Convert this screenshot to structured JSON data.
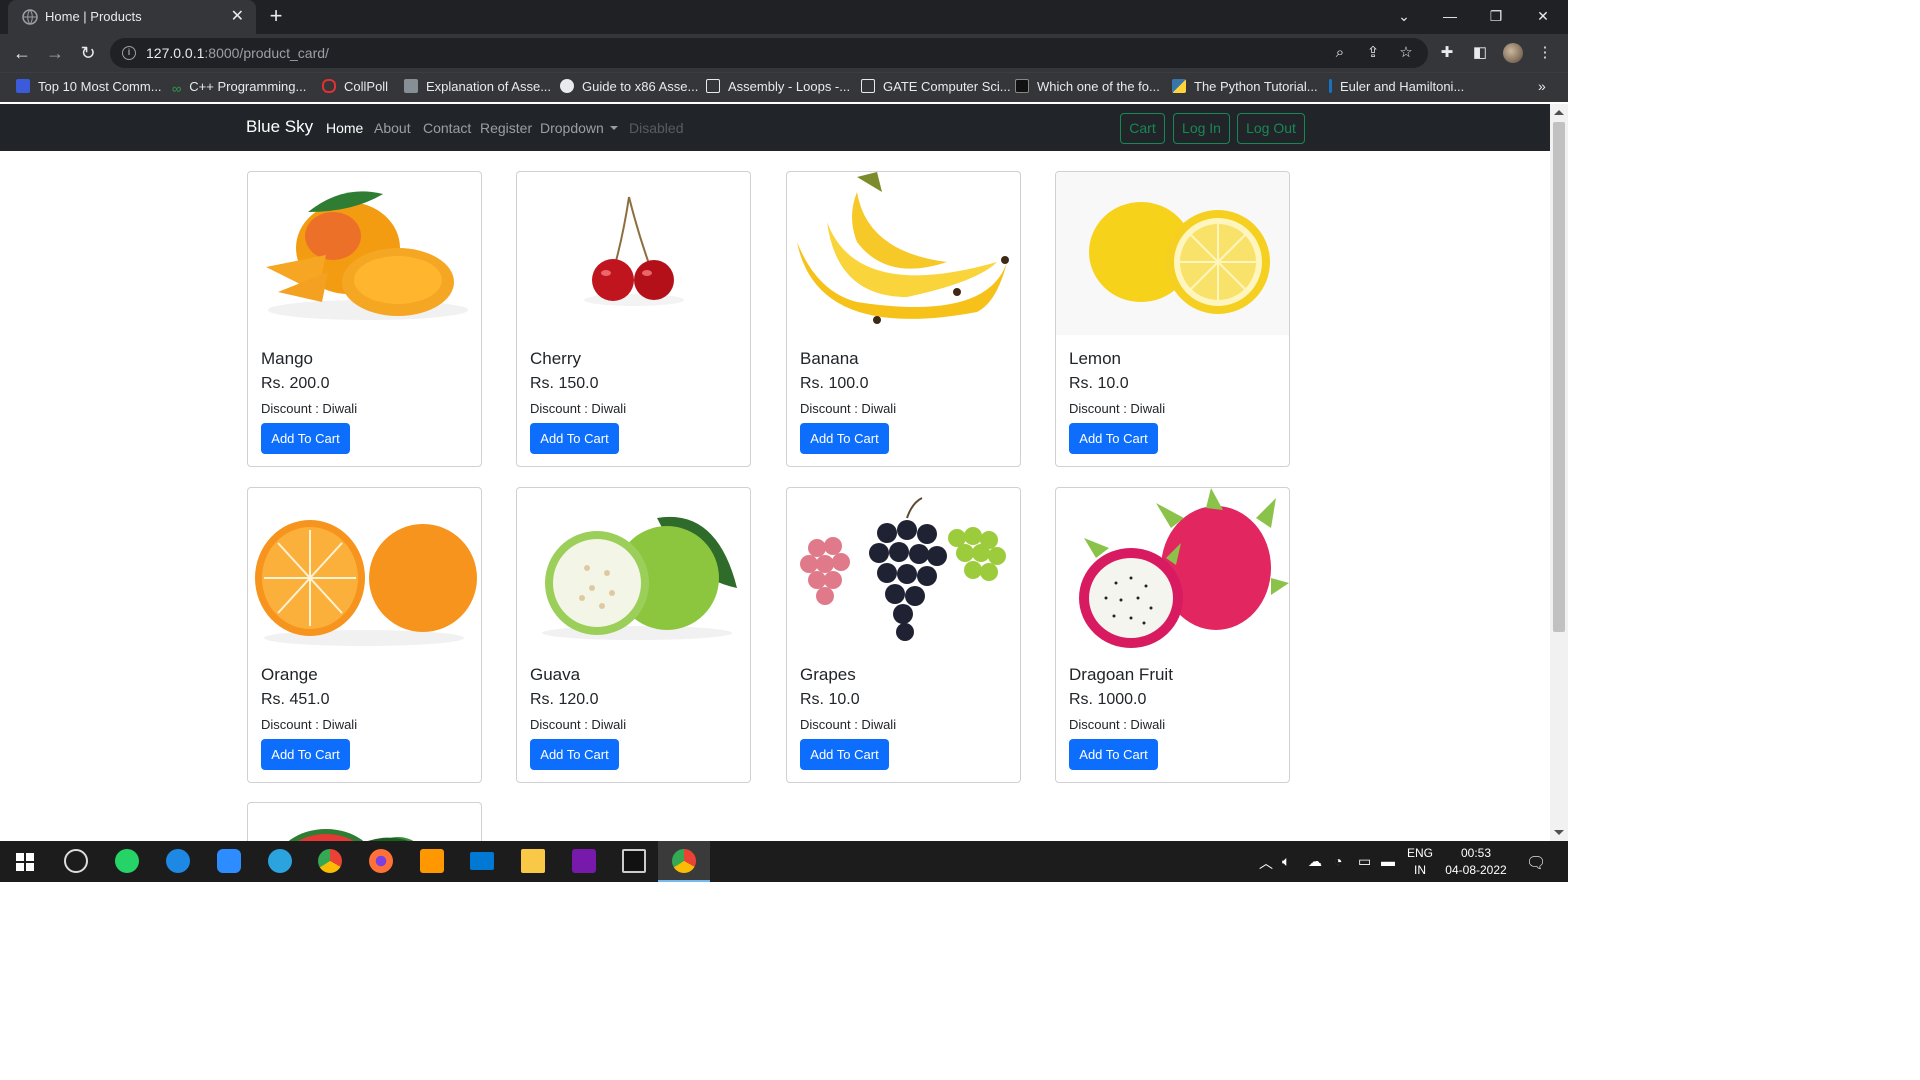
{
  "browser": {
    "tab_title": "Home | Products",
    "url_host": "127.0.0.1",
    "url_path": ":8000/product_card/",
    "bookmarks": [
      {
        "label": "Top 10 Most Comm...",
        "icon": "bookmark-icon-blue"
      },
      {
        "label": "C++ Programming...",
        "icon": "infinity-icon"
      },
      {
        "label": "CollPoll",
        "icon": "speech-bubble-icon"
      },
      {
        "label": "Explanation of Asse...",
        "icon": "badge-icon"
      },
      {
        "label": "Guide to x86 Asse...",
        "icon": "globe-icon"
      },
      {
        "label": "Assembly - Loops -...",
        "icon": "hex-logo-icon"
      },
      {
        "label": "GATE Computer Sci...",
        "icon": "hex-logo-icon"
      },
      {
        "label": "Which one of the fo...",
        "icon": "folder-icon"
      },
      {
        "label": "The Python Tutorial...",
        "icon": "python-icon"
      },
      {
        "label": "Euler and Hamiltoni...",
        "icon": "bookmark-icon-blue"
      }
    ],
    "bookmarks_more": "»"
  },
  "navbar": {
    "brand": "Blue Sky",
    "links": [
      "Home",
      "About",
      "Contact",
      "Register",
      "Dropdown",
      "Disabled"
    ],
    "buttons": [
      "Cart",
      "Log In",
      "Log Out"
    ]
  },
  "products": [
    {
      "name": "Mango",
      "price": "Rs. 200.0",
      "discount": "Discount : Diwali",
      "button": "Add To Cart"
    },
    {
      "name": "Cherry",
      "price": "Rs. 150.0",
      "discount": "Discount : Diwali",
      "button": "Add To Cart"
    },
    {
      "name": "Banana",
      "price": "Rs. 100.0",
      "discount": "Discount : Diwali",
      "button": "Add To Cart"
    },
    {
      "name": "Lemon",
      "price": "Rs. 10.0",
      "discount": "Discount : Diwali",
      "button": "Add To Cart"
    },
    {
      "name": "Orange",
      "price": "Rs. 451.0",
      "discount": "Discount : Diwali",
      "button": "Add To Cart"
    },
    {
      "name": "Guava",
      "price": "Rs. 120.0",
      "discount": "Discount : Diwali",
      "button": "Add To Cart"
    },
    {
      "name": "Grapes",
      "price": "Rs. 10.0",
      "discount": "Discount : Diwali",
      "button": "Add To Cart"
    },
    {
      "name": "Dragoan Fruit",
      "price": "Rs. 1000.0",
      "discount": "Discount : Diwali",
      "button": "Add To Cart"
    }
  ],
  "taskbar": {
    "lang": "ENG",
    "region": "IN",
    "time": "00:53",
    "date": "04-08-2022"
  }
}
